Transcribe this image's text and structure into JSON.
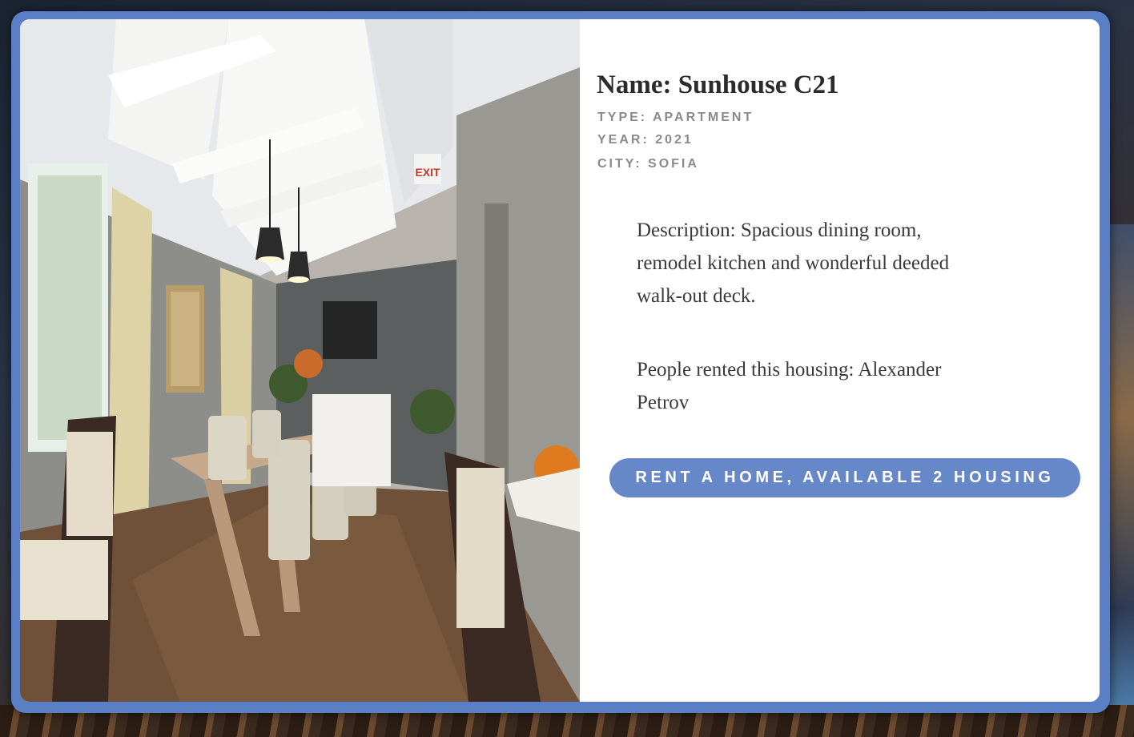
{
  "listing": {
    "name": "Name: Sunhouse C21",
    "type": "TYPE: APARTMENT",
    "year": "YEAR: 2021",
    "city": "CITY: SOFIA",
    "description": "Description: Spacious dining room, remodel kitchen and wonderful deeded walk-out deck.",
    "people": "People rented this housing: Alexander Petrov",
    "rent_button": "RENT A HOME, AVAILABLE 2 HOUSING",
    "photo_exit_sign": "EXIT"
  },
  "colors": {
    "accent": "#6688c9",
    "frame": "#5b7fc4",
    "title_text": "#2b2b2b",
    "meta_text": "#8a8a8a"
  }
}
